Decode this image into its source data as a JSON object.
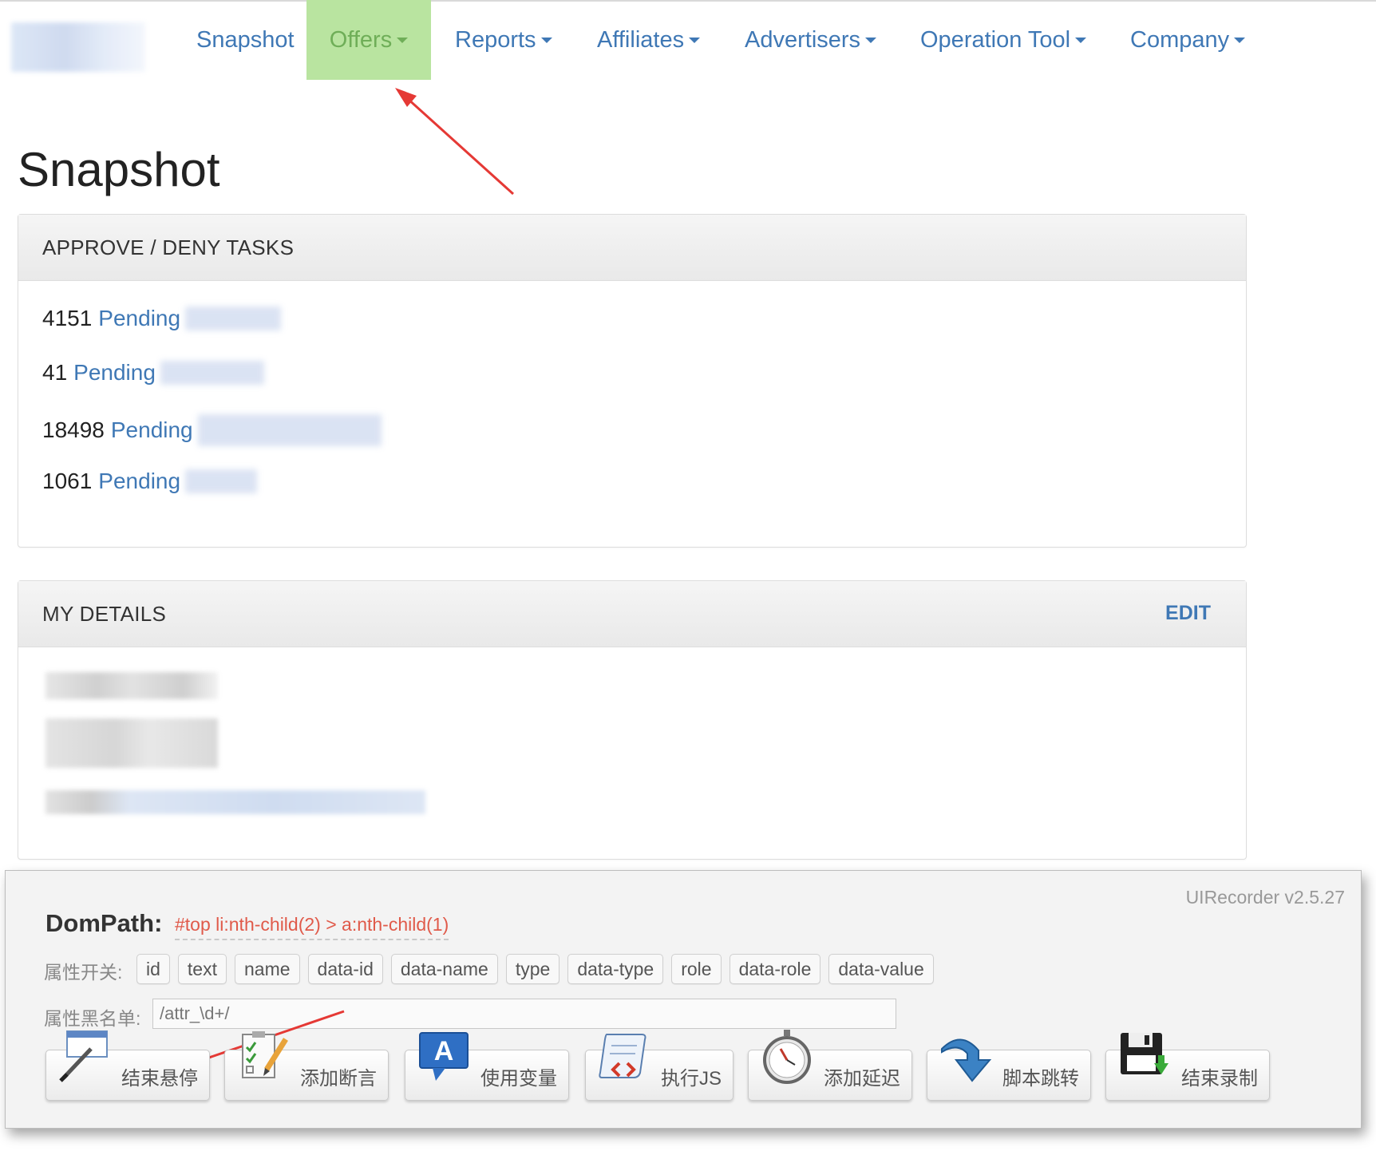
{
  "nav": {
    "items": [
      {
        "label": "Snapshot",
        "has_caret": false
      },
      {
        "label": "Offers",
        "has_caret": true,
        "active": true
      },
      {
        "label": "Reports",
        "has_caret": true
      },
      {
        "label": "Affiliates",
        "has_caret": true
      },
      {
        "label": "Advertisers",
        "has_caret": true
      },
      {
        "label": "Operation Tool",
        "has_caret": true
      },
      {
        "label": "Company",
        "has_caret": true
      }
    ]
  },
  "page": {
    "title": "Snapshot"
  },
  "tasks_panel": {
    "title": "APPROVE / DENY TASKS",
    "rows": [
      {
        "count": "4151",
        "link": "Pending"
      },
      {
        "count": "41",
        "link": "Pending"
      },
      {
        "count": "18498",
        "link": "Pending"
      },
      {
        "count": "1061",
        "link": "Pending"
      }
    ]
  },
  "details_panel": {
    "title": "MY DETAILS",
    "edit_label": "EDIT"
  },
  "recorder": {
    "version": "UIRecorder v2.5.27",
    "dompath_label": "DomPath:",
    "dompath_value": "#top li:nth-child(2) > a:nth-child(1)",
    "attr_switch_label": "属性开关:",
    "attrs": [
      "id",
      "text",
      "name",
      "data-id",
      "data-name",
      "type",
      "data-type",
      "role",
      "data-role",
      "data-value"
    ],
    "blacklist_label": "属性黑名单:",
    "blacklist_value": "/attr_\\d+/",
    "actions": [
      {
        "label": "结束悬停",
        "icon": "hover-end-icon"
      },
      {
        "label": "添加断言",
        "icon": "checklist-pencil-icon"
      },
      {
        "label": "使用变量",
        "icon": "variable-a-icon"
      },
      {
        "label": "执行JS",
        "icon": "script-scroll-icon"
      },
      {
        "label": "添加延迟",
        "icon": "stopwatch-icon"
      },
      {
        "label": "脚本跳转",
        "icon": "jump-arrow-icon"
      },
      {
        "label": "结束录制",
        "icon": "floppy-save-icon"
      }
    ]
  },
  "colors": {
    "link": "#3f78b5",
    "active_nav_bg": "#b9e4a0",
    "active_nav_text": "#6fae58",
    "dompath_text": "#e05a4a",
    "annotation_arrow": "#e53935"
  }
}
